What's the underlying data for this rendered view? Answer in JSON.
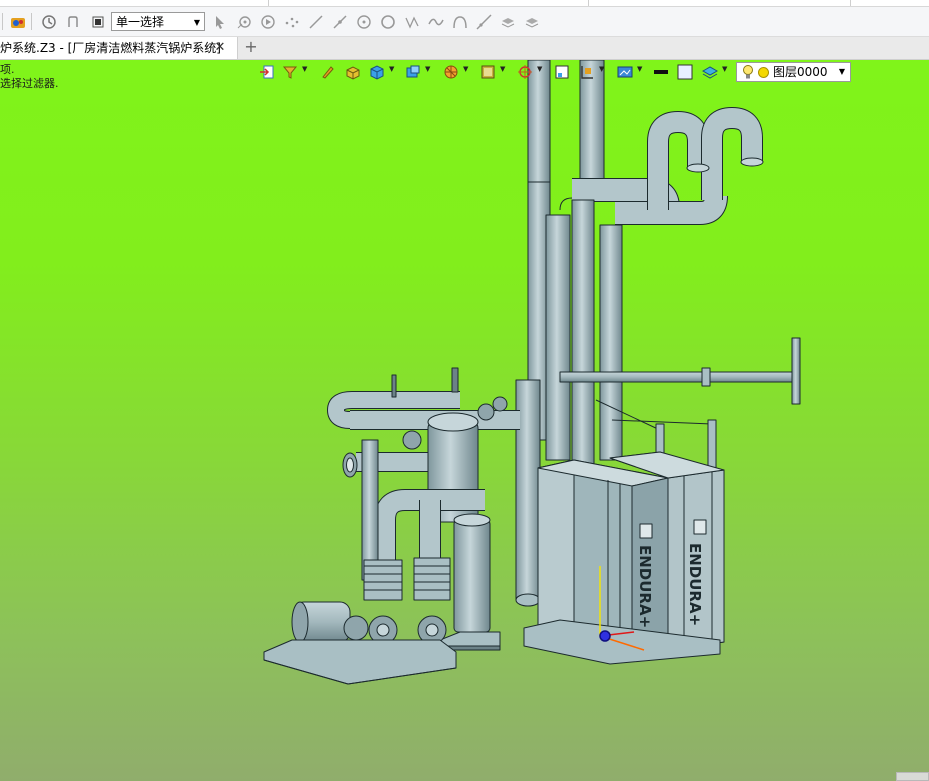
{
  "toolbar": {
    "select_mode": "单一选择"
  },
  "tabs": {
    "document_label": "炉系统.Z3 - [厂房清洁燃料蒸汽锅炉系统]",
    "close_glyph": "✕",
    "new_glyph": "+"
  },
  "status": {
    "line1": "项.",
    "line2": "选择过滤器."
  },
  "layer": {
    "name": "图层0000"
  },
  "model": {
    "boiler_brand_left": "ENDURA+",
    "boiler_brand_right": "ENDURA+"
  },
  "colors": {
    "viewport_top": "#80f41a",
    "viewport_bottom": "#90ad6c",
    "model_fill": "#a9bfc4",
    "model_edge": "#1c2a2e"
  }
}
